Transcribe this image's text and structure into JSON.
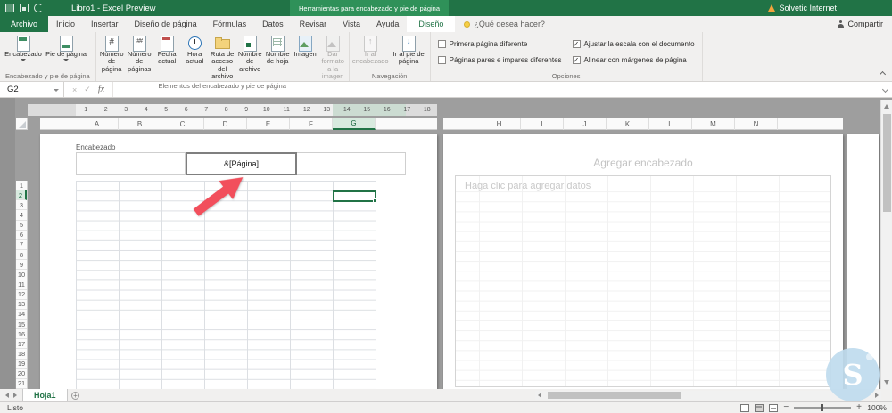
{
  "titlebar": {
    "title": "Libro1 - Excel Preview",
    "contextual_group": "Herramientas para encabezado y pie de página",
    "account": "Solvetic Internet"
  },
  "ribbon_tabs": {
    "file": "Archivo",
    "main": [
      "Inicio",
      "Insertar",
      "Diseño de página",
      "Fórmulas",
      "Datos",
      "Revisar",
      "Vista",
      "Ayuda"
    ],
    "contextual": "Diseño",
    "tell_me": "¿Qué desea hacer?",
    "share": "Compartir"
  },
  "ribbon": {
    "groups": [
      {
        "name": "Encabezado y pie de página",
        "buttons": [
          {
            "label": "Encabezado",
            "icon": "header",
            "dropdown": true
          },
          {
            "label": "Pie de página",
            "icon": "footer",
            "dropdown": true
          }
        ]
      },
      {
        "name": "Elementos del encabezado y pie de página",
        "buttons": [
          {
            "label": "Número de página",
            "icon": "page-number"
          },
          {
            "label": "Número de páginas",
            "icon": "page-count"
          },
          {
            "label": "Fecha actual",
            "icon": "date"
          },
          {
            "label": "Hora actual",
            "icon": "time"
          },
          {
            "label": "Ruta de acceso del archivo",
            "icon": "file-path"
          },
          {
            "label": "Nombre de archivo",
            "icon": "file-name"
          },
          {
            "label": "Nombre de hoja",
            "icon": "sheet-name"
          },
          {
            "label": "Imagen",
            "icon": "picture"
          },
          {
            "label": "Dar formato a la imagen",
            "icon": "format-picture",
            "disabled": true
          }
        ]
      },
      {
        "name": "Navegación",
        "buttons": [
          {
            "label": "Ir al encabezado",
            "icon": "goto-header",
            "disabled": true
          },
          {
            "label": "Ir al pie de página",
            "icon": "goto-footer"
          }
        ]
      },
      {
        "name": "Opciones",
        "checkboxes": [
          {
            "label": "Primera página diferente",
            "checked": false
          },
          {
            "label": "Páginas pares e impares diferentes",
            "checked": false
          },
          {
            "label": "Ajustar la escala con el documento",
            "checked": true
          },
          {
            "label": "Alinear con márgenes de página",
            "checked": true
          }
        ]
      }
    ]
  },
  "formula_bar": {
    "name_box": "G2",
    "value": ""
  },
  "ruler": {
    "numbers": [
      "1",
      "2",
      "3",
      "4",
      "5",
      "6",
      "7",
      "8",
      "9",
      "10",
      "11",
      "12",
      "13",
      "14",
      "15",
      "16",
      "17",
      "18"
    ]
  },
  "sheet": {
    "page1_columns": [
      "A",
      "B",
      "C",
      "D",
      "E",
      "F",
      "G"
    ],
    "page2_columns": [
      "H",
      "I",
      "J",
      "K",
      "L",
      "M",
      "N"
    ],
    "rows": [
      1,
      2,
      3,
      4,
      5,
      6,
      7,
      8,
      9,
      10,
      11,
      12,
      13,
      14,
      15,
      16,
      17,
      18,
      19,
      20,
      21
    ],
    "selected_column": "G",
    "selected_row": 2,
    "header_section_label": "Encabezado",
    "header_center_value": "&[Página]",
    "page2_header_placeholder": "Agregar encabezado",
    "page2_data_placeholder": "Haga clic para agregar datos"
  },
  "sheet_tabs": {
    "active": "Hoja1"
  },
  "status_bar": {
    "status": "Listo",
    "zoom": "100%"
  },
  "colors": {
    "accent": "#217346",
    "arrow": "#f24f5c"
  }
}
